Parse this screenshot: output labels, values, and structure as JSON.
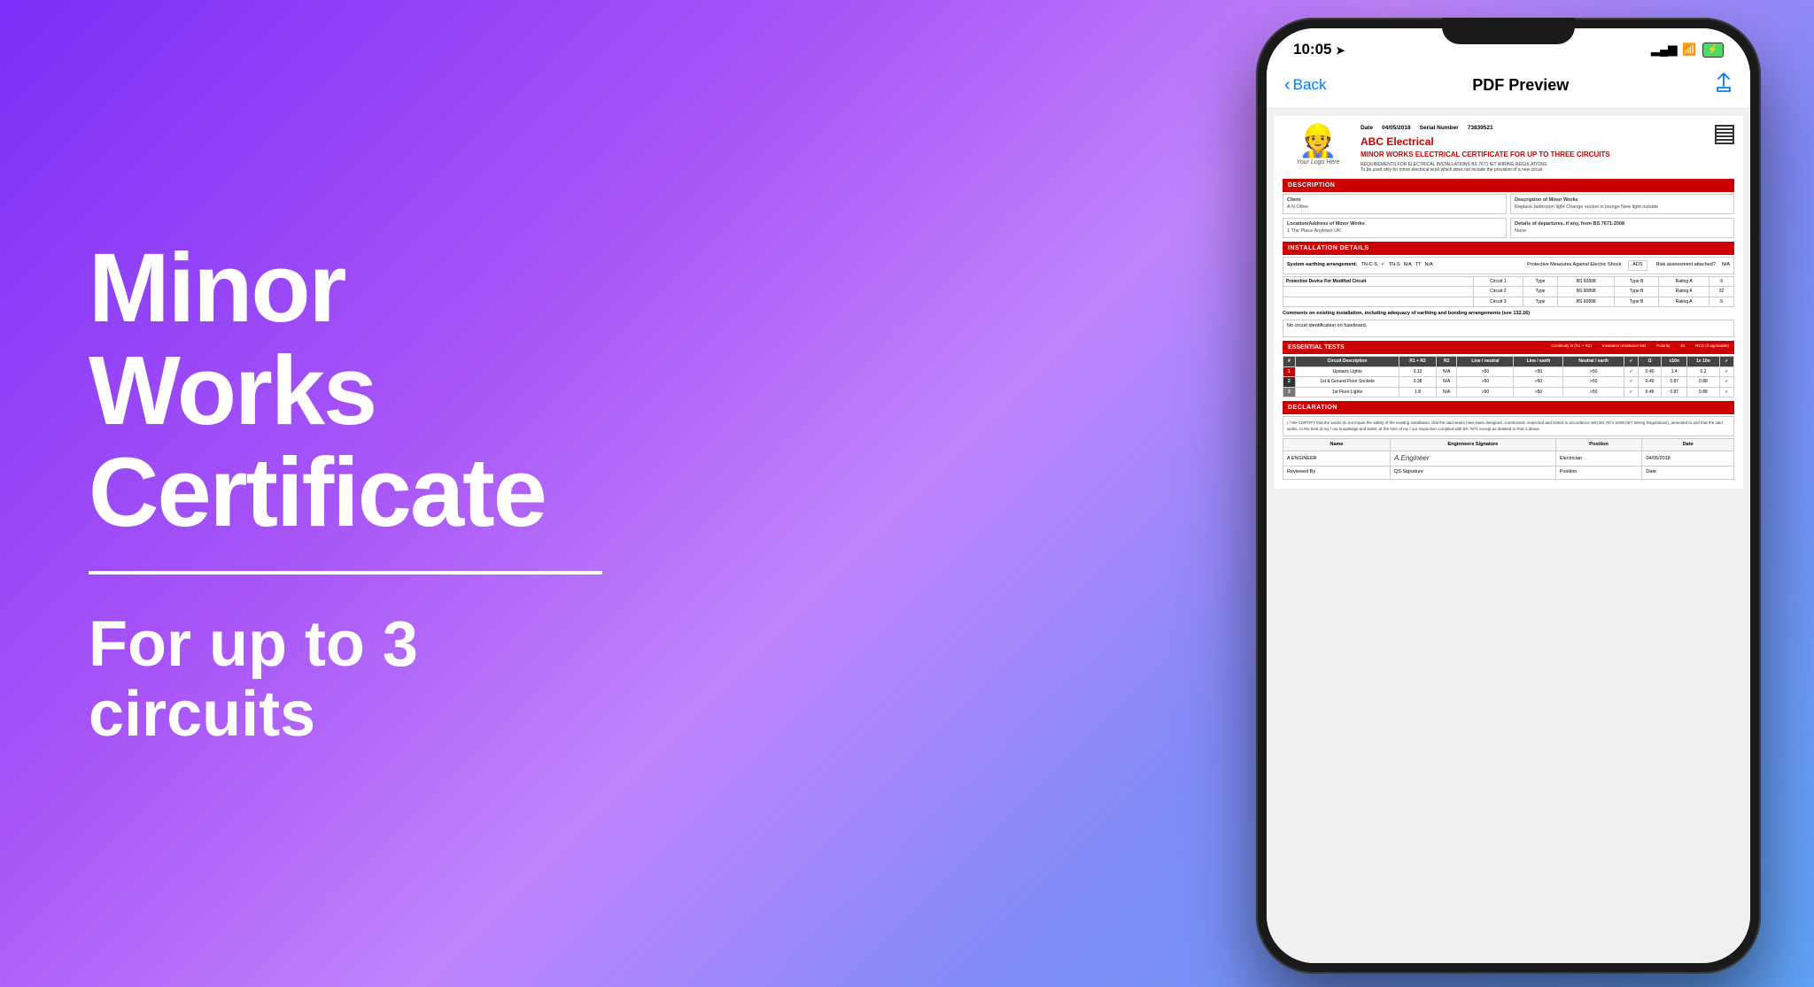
{
  "background": {
    "gradient": "135deg, #7b2ff7 0%, #a855f7 30%, #c084fc 50%, #818cf8 70%, #60a5fa 100%"
  },
  "left": {
    "title_line1": "Minor Works",
    "title_line2": "Certificate",
    "subtitle": "For up to 3 circuits"
  },
  "phone": {
    "status": {
      "time": "10:05",
      "location_icon": "➤",
      "signal": "▂▄▆",
      "wifi": "WiFi",
      "battery": "⚡"
    },
    "nav": {
      "back_label": "Back",
      "title": "PDF Preview",
      "share_icon": "↑"
    },
    "pdf": {
      "logo_placeholder": "Your Logo Here",
      "date_label": "Date",
      "date_value": "04/05/2018",
      "serial_label": "Serial Number",
      "serial_value": "73839521",
      "company_name": "ABC Electrical",
      "cert_title": "MINOR WORKS ELECTRICAL CERTIFICATE FOR UP TO THREE CIRCUITS",
      "requirements": "REQUIREMENTS FOR ELECTRICAL INSTALLATIONS BS 7671 IET WIRING REGULATIONS",
      "requirements_sub": "To be used only for minor electrical work which does not include the provision of a new circuit",
      "sections": {
        "description": "DESCRIPTION",
        "installation": "INSTALLATION DETAILS",
        "essential_tests": "ESSENTIAL TESTS",
        "declaration": "DECLARATION"
      },
      "desc_of_minor_works_label": "Description of Minor Works",
      "desc_of_minor_works_value": "Replace bathroom light\nChange socket in lounge\nNew light outside",
      "client_label": "Client",
      "client_value": "A N Other",
      "location_label": "Location/Address of Minor Works",
      "location_value": "1 The Place\nAnytown\nUK",
      "departures_label": "Details of departures, if any, from BS 7671:2008",
      "departures_value": "None",
      "earthing_label": "System earthing arrangement:",
      "earthing_options": [
        "TN-C-S",
        "TN-S",
        "N/A",
        "TT",
        "N/A"
      ],
      "protective_measures_label": "Protective Measures Against Electric Shock",
      "protective_measures_value": "ADS",
      "risk_label": "Risk assessment attached?",
      "risk_value": "N/A",
      "circuit_device_label": "Protective Device For Modified Circuit",
      "circuits": [
        {
          "num": "Circuit 1",
          "type_label": "Type",
          "bs": "BS 60898",
          "type_val": "Type B",
          "rating_label": "Rating A",
          "rating_val": "6"
        },
        {
          "num": "Circuit 2",
          "type_label": "Type",
          "bs": "BS 90898",
          "type_val": "Type B",
          "rating_label": "Rating A",
          "rating_val": "32"
        },
        {
          "num": "Circuit 3",
          "type_label": "Type",
          "bs": "BS 60898",
          "type_val": "Type B",
          "rating_label": "Rating A",
          "rating_val": "6"
        }
      ],
      "comments_label": "Comments on existing installation, including adequacy of earthing and bonding arrangements (see 132.16)",
      "comments_value": "No circuit identification on fuseboard.",
      "test_cols": [
        "R1 + R2",
        "R2",
        "Line / neutral",
        "Line / earth",
        "Neutral / earth",
        "✓",
        "Ω",
        "x10n",
        "1x 10n",
        "✓"
      ],
      "test_rows": [
        {
          "num": "1",
          "desc": "Upstairs Lights",
          "r1r2": "0.12",
          "r2": "N/A",
          "ln": ">50",
          "le": ">50",
          "ne": ">50",
          "chk1": "✓",
          "ohm": "0.45",
          "x10n": "1.4",
          "x1x10n": "0.2",
          "chk2": "✓"
        },
        {
          "num": "2",
          "desc": "1st & Ground Floor Sockets",
          "r1r2": "0.38",
          "r2": "N/A",
          "ln": ">50",
          "le": ">50",
          "ne": ">50",
          "chk1": "✓",
          "ohm": "0.45",
          "x10n": "0.87",
          "x1x10n": "0.88",
          "chk2": "✓"
        },
        {
          "num": "3",
          "desc": "1st Floor Lights",
          "r1r2": "1.8",
          "r2": "N/A",
          "ln": ">50",
          "le": ">50",
          "ne": ">50",
          "chk1": "✓",
          "ohm": "0.45",
          "x10n": "0.87",
          "x1x10n": "0.88",
          "chk2": "✓"
        }
      ],
      "declaration_text": "I / We CERTIFY that the works do not impair the safety of the existing installation, that the said works have been designed, constructed, inspected and tested in accordance with BS 7671:2008 (IET Wiring Regulations), amended to                    and that the said works, to the best of my / our knowledge and belief, at the time of my / our inspection complied with BS 7671 except as detailed in Part 1 above.",
      "name_label": "Name",
      "name_value": "A ENGINEER",
      "eng_sig_label": "Enginneers Signature",
      "eng_sig_value": "A.Engineer",
      "position_label": "Position",
      "position_value": "Electrician",
      "date_sign_label": "Date",
      "date_sign_value": "04/05/2018",
      "reviewed_by_label": "Reviewed By",
      "qs_sig_label": "QS Signature",
      "reviewed_position_label": "Position",
      "reviewed_date_label": "Date"
    }
  }
}
